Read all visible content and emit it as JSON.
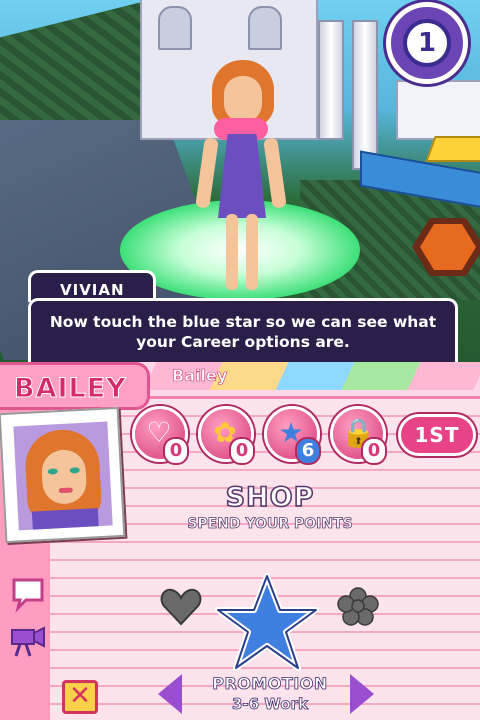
{
  "scene": {
    "turn_number": "1"
  },
  "dialog": {
    "speaker": "VIVIAN",
    "text": "Now touch the blue star so we can see what your Career options are."
  },
  "player": {
    "name": "BAILEY",
    "tab_name": "Bailey",
    "rank": "1ST"
  },
  "stats": [
    {
      "icon": "heart-icon",
      "count": "0"
    },
    {
      "icon": "flower-icon",
      "count": "0"
    },
    {
      "icon": "star-icon",
      "count": "6"
    },
    {
      "icon": "lock-icon",
      "count": "0"
    }
  ],
  "shop": {
    "title": "SHOP",
    "subtitle": "SPEND YOUR POINTS"
  },
  "promotion": {
    "title": "PROMOTION",
    "subtitle": "3-6 Work"
  },
  "colors": {
    "stripe_colors": [
      "#ffb8d4",
      "#ffd98a",
      "#8fd8ff",
      "#a7e8a0",
      "#ffb8d4"
    ],
    "accent_pink": "#e84386",
    "selected_star": "#3f7fe0"
  }
}
